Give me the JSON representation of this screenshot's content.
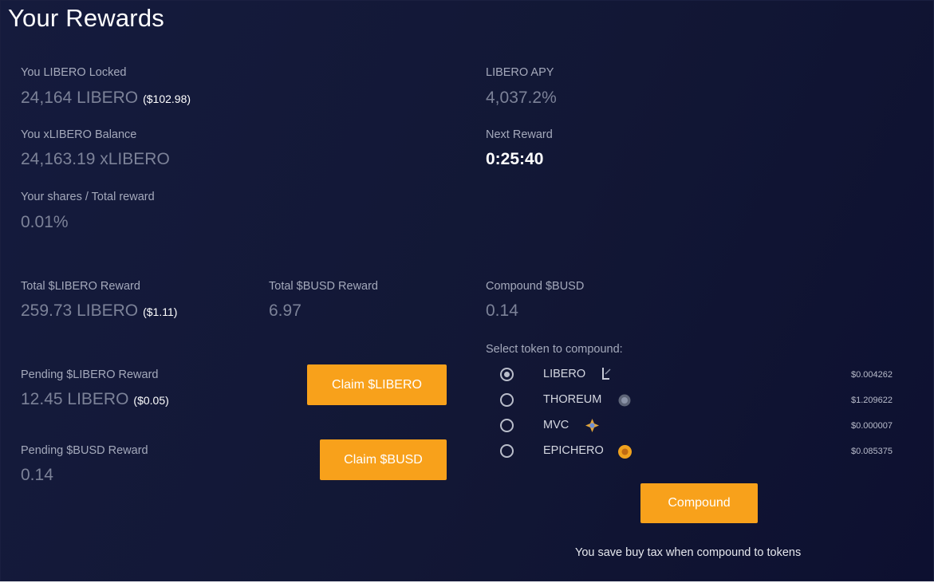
{
  "header": {
    "title": "Your Rewards"
  },
  "locked": {
    "label": "You LIBERO Locked",
    "value": "24,164 LIBERO",
    "usd": "($102.98)"
  },
  "apy": {
    "label": "LIBERO APY",
    "value": "4,037.2%"
  },
  "balance": {
    "label": "You xLIBERO Balance",
    "value": "24,163.19 xLIBERO"
  },
  "next_reward": {
    "label": "Next Reward",
    "value": "0:25:40"
  },
  "shares": {
    "label": "Your shares / Total reward",
    "value": "0.01%"
  },
  "total_libero": {
    "label": "Total $LIBERO Reward",
    "value": "259.73 LIBERO",
    "usd": "($1.11)"
  },
  "total_busd": {
    "label": "Total $BUSD Reward",
    "value": "6.97"
  },
  "compound_busd": {
    "label": "Compound $BUSD",
    "value": "0.14"
  },
  "pending_libero": {
    "label": "Pending $LIBERO Reward",
    "value": "12.45 LIBERO",
    "usd": "($0.05)",
    "button": "Claim $LIBERO"
  },
  "pending_busd": {
    "label": "Pending $BUSD Reward",
    "value": "0.14",
    "button": "Claim $BUSD"
  },
  "compound": {
    "select_label": "Select token to compound:",
    "tokens": [
      {
        "name": "LIBERO",
        "price": "$0.004262",
        "selected": true,
        "icon": "libero-token-icon"
      },
      {
        "name": "THOREUM",
        "price": "$1.209622",
        "selected": false,
        "icon": "thoreum-token-icon"
      },
      {
        "name": "MVC",
        "price": "$0.000007",
        "selected": false,
        "icon": "mvc-token-icon"
      },
      {
        "name": "EPICHERO",
        "price": "$0.085375",
        "selected": false,
        "icon": "epichero-token-icon"
      }
    ],
    "button": "Compound",
    "note": "You save buy tax when compound to tokens"
  },
  "colors": {
    "background": "#131838",
    "button": "#f8a11b",
    "muted_value": "#7c8298",
    "label": "#a4a9bb"
  }
}
